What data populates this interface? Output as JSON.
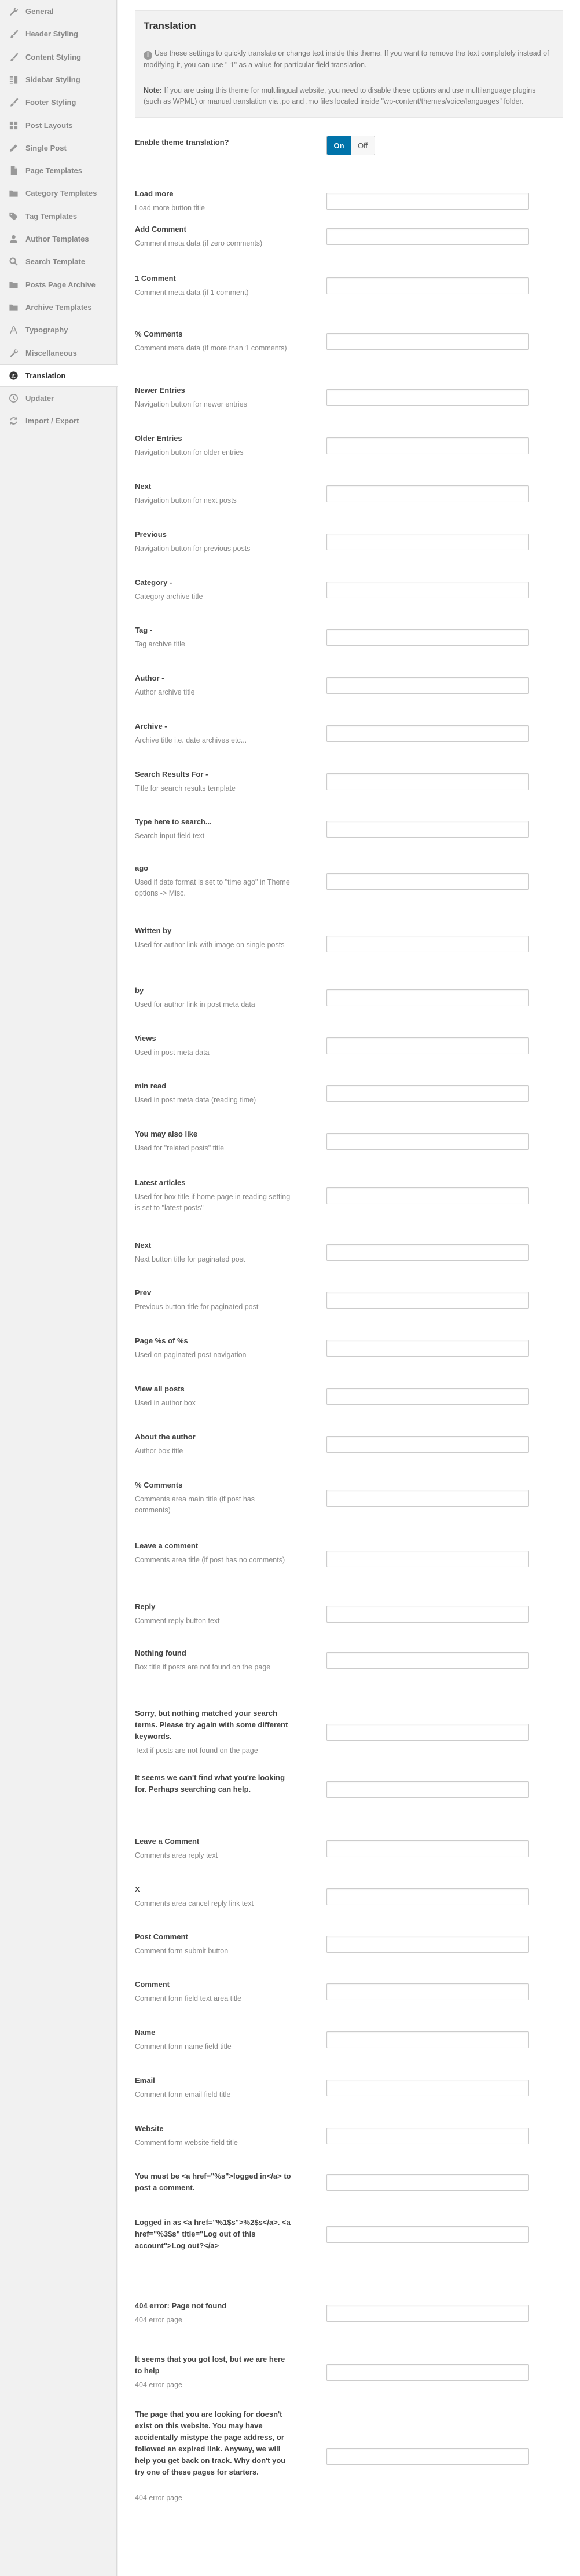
{
  "sidebar": {
    "items": [
      {
        "label": "General",
        "icon": "wrench-icon",
        "active": false
      },
      {
        "label": "Header Styling",
        "icon": "brush-icon",
        "active": false
      },
      {
        "label": "Content Styling",
        "icon": "brush-icon",
        "active": false
      },
      {
        "label": "Sidebar Styling",
        "icon": "columns-icon",
        "active": false
      },
      {
        "label": "Footer Styling",
        "icon": "brush-icon",
        "active": false
      },
      {
        "label": "Post Layouts",
        "icon": "grid-icon",
        "active": false
      },
      {
        "label": "Single Post",
        "icon": "pencil-icon",
        "active": false
      },
      {
        "label": "Page Templates",
        "icon": "page-icon",
        "active": false
      },
      {
        "label": "Category Templates",
        "icon": "folder-icon",
        "active": false
      },
      {
        "label": "Tag Templates",
        "icon": "tag-icon",
        "active": false
      },
      {
        "label": "Author Templates",
        "icon": "user-icon",
        "active": false
      },
      {
        "label": "Search Template",
        "icon": "search-icon",
        "active": false
      },
      {
        "label": "Posts Page Archive",
        "icon": "folder-icon",
        "active": false
      },
      {
        "label": "Archive Templates",
        "icon": "folder-icon",
        "active": false
      },
      {
        "label": "Typography",
        "icon": "typography-icon",
        "active": false
      },
      {
        "label": "Miscellaneous",
        "icon": "wrench-icon",
        "active": false
      },
      {
        "label": "Translation",
        "icon": "translation-icon",
        "active": true
      },
      {
        "label": "Updater",
        "icon": "clock-icon",
        "active": false
      },
      {
        "label": "Import / Export",
        "icon": "refresh-icon",
        "active": false
      }
    ]
  },
  "header": {
    "title": "Translation",
    "info": "Use these settings to quickly translate or change text inside this theme. If you want to remove the text completely instead of modifying it, you can use \"-1\" as a value for particular field translation.",
    "note_label": "Note:",
    "note": "If you are using this theme for multilingual website, you need to disable these options and use multilanguage plugins (such as WPML) or manual translation via .po and .mo files located inside \"wp-content/themes/voice/languages\" folder."
  },
  "toggle": {
    "label": "Enable theme translation?",
    "on": "On",
    "off": "Off",
    "value": "On"
  },
  "fields": [
    {
      "label": "Load more",
      "desc": "Load more button title",
      "value": ""
    },
    {
      "label": "Add Comment",
      "desc": "Comment meta data (if zero comments)",
      "value": ""
    },
    {
      "label": "1 Comment",
      "desc": "Comment meta data (if 1 comment)",
      "value": ""
    },
    {
      "label": "% Comments",
      "desc": "Comment meta data (if more than 1 comments)",
      "value": ""
    },
    {
      "label": "Newer Entries",
      "desc": "Navigation button for newer entries",
      "value": ""
    },
    {
      "label": "Older Entries",
      "desc": "Navigation button for older entries",
      "value": ""
    },
    {
      "label": "Next",
      "desc": "Navigation button for next posts",
      "value": ""
    },
    {
      "label": "Previous",
      "desc": "Navigation button for previous posts",
      "value": ""
    },
    {
      "label": "Category -",
      "desc": "Category archive title",
      "value": ""
    },
    {
      "label": "Tag -",
      "desc": "Tag archive title",
      "value": ""
    },
    {
      "label": "Author -",
      "desc": "Author archive title",
      "value": ""
    },
    {
      "label": "Archive -",
      "desc": "Archive title i.e. date archives etc...",
      "value": ""
    },
    {
      "label": "Search Results For -",
      "desc": "Title for search results template",
      "value": ""
    },
    {
      "label": "Type here to search...",
      "desc": "Search input field text",
      "value": ""
    },
    {
      "label": "ago",
      "desc": "Used if date format is set to \"time ago\" in Theme options -> Misc.",
      "value": ""
    },
    {
      "label": "Written by",
      "desc": "Used for author link with image on single posts",
      "value": ""
    },
    {
      "label": "by",
      "desc": "Used for author link in post meta data",
      "value": ""
    },
    {
      "label": "Views",
      "desc": "Used in post meta data",
      "value": ""
    },
    {
      "label": "min read",
      "desc": "Used in post meta data (reading time)",
      "value": ""
    },
    {
      "label": "You may also like",
      "desc": "Used for \"related posts\" title",
      "value": ""
    },
    {
      "label": "Latest articles",
      "desc": "Used for box title if home page in reading setting is set to \"latest posts\"",
      "value": ""
    },
    {
      "label": "Next",
      "desc": "Next button title for paginated post",
      "value": ""
    },
    {
      "label": "Prev",
      "desc": "Previous button title for paginated post",
      "value": ""
    },
    {
      "label": "Page %s of %s",
      "desc": "Used on paginated post navigation",
      "value": ""
    },
    {
      "label": "View all posts",
      "desc": "Used in author box",
      "value": ""
    },
    {
      "label": "About the author",
      "desc": "Author box title",
      "value": ""
    },
    {
      "label": "% Comments",
      "desc": "Comments area main title (if post has comments)",
      "value": ""
    },
    {
      "label": "Leave a comment",
      "desc": "Comments area title (if post has no comments)",
      "value": ""
    },
    {
      "label": "Reply",
      "desc": "Comment reply button text",
      "value": ""
    },
    {
      "label": "Nothing found",
      "desc": "Box title if posts are not found on the page",
      "value": ""
    },
    {
      "label": "Sorry, but nothing matched your search terms. Please try again with some different keywords.",
      "desc": "Text if posts are not found on the page",
      "value": ""
    },
    {
      "label": "It seems we can't find what you're looking for. Perhaps searching can help.",
      "desc": "",
      "value": ""
    },
    {
      "label": "Leave a Comment",
      "desc": "Comments area reply text",
      "value": ""
    },
    {
      "label": "X",
      "desc": "Comments area cancel reply link text",
      "value": ""
    },
    {
      "label": "Post Comment",
      "desc": "Comment form submit button",
      "value": ""
    },
    {
      "label": "Comment",
      "desc": "Comment form field text area title",
      "value": ""
    },
    {
      "label": "Name",
      "desc": "Comment form name field title",
      "value": ""
    },
    {
      "label": "Email",
      "desc": "Comment form email field title",
      "value": ""
    },
    {
      "label": "Website",
      "desc": "Comment form website field title",
      "value": ""
    },
    {
      "label": "You must be <a href=\"%s\">logged in</a> to post a comment.",
      "desc": "",
      "value": ""
    },
    {
      "label": "Logged in as <a href=\"%1$s\">%2$s</a>. <a href=\"%3$s\" title=\"Log out of this account\">Log out?</a>",
      "desc": "",
      "value": ""
    },
    {
      "label": "404 error: Page not found",
      "desc": "404 error page",
      "value": ""
    },
    {
      "label": "It seems that you got lost, but we are here to help",
      "desc": "404 error page",
      "value": ""
    },
    {
      "label": "The page that you are looking for doesn't exist on this website. You may have accidentally mistype the page address, or followed an expired link. Anyway, we will help you get back on track. Why don't you try one of these pages for starters.",
      "desc": "404 error page",
      "value": ""
    }
  ],
  "colors": {
    "accent": "#0073aa",
    "sidebar_bg": "#f1f1f1",
    "content_bg": "#ffffff"
  }
}
